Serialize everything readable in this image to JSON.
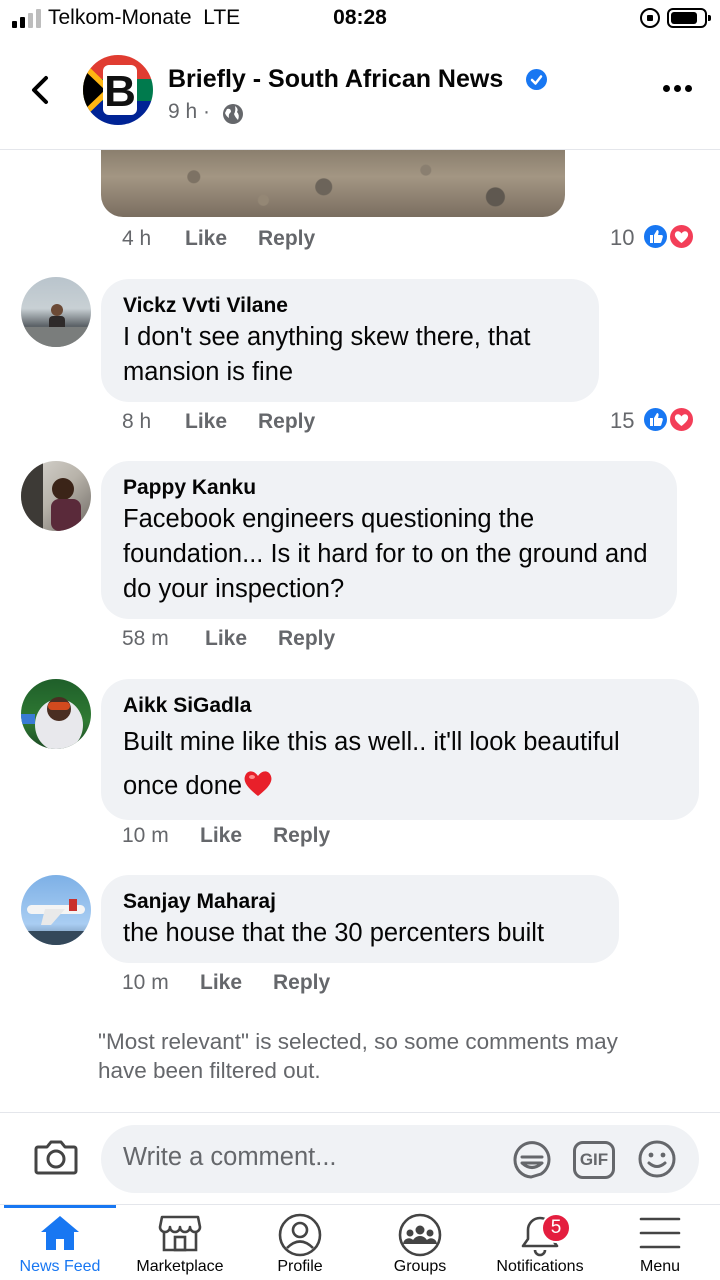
{
  "status_bar": {
    "carrier": "Telkom-Monate  LTE",
    "time": "08:28"
  },
  "header": {
    "title": "Briefly - South African News",
    "time": "9 h ·",
    "icons": [
      "back-icon",
      "verified-icon",
      "globe-icon",
      "more-icon"
    ]
  },
  "comments": [
    {
      "time": "4 h",
      "like": "Like",
      "reply": "Reply",
      "reactions": "10"
    },
    {
      "name": "Vickz Vvti Vilane",
      "text": "I don't see anything skew there, that mansion is fine",
      "time": "8 h",
      "like": "Like",
      "reply": "Reply",
      "reactions": "15"
    },
    {
      "name": "Pappy Kanku",
      "text": "Facebook engineers questioning the foundation... Is it hard for to on the ground and do your inspection?",
      "time": "58 m",
      "like": "Like",
      "reply": "Reply"
    },
    {
      "name": "Aikk SiGadla",
      "text": "Built mine like this as well.. it'll look beautiful once done",
      "emoji": "heart",
      "time": "10 m",
      "like": "Like",
      "reply": "Reply"
    },
    {
      "name": "Sanjay Maharaj",
      "text": "the house that the 30 percenters built",
      "time": "10 m",
      "like": "Like",
      "reply": "Reply"
    }
  ],
  "filter_note": "\"Most relevant\" is selected, so some comments may have been filtered out.",
  "composer": {
    "placeholder": "Write a comment...",
    "gif_label": "GIF"
  },
  "tabs": [
    {
      "label": "News Feed",
      "icon": "home-icon",
      "active": true
    },
    {
      "label": "Marketplace",
      "icon": "marketplace-icon"
    },
    {
      "label": "Profile",
      "icon": "profile-icon"
    },
    {
      "label": "Groups",
      "icon": "groups-icon"
    },
    {
      "label": "Notifications",
      "icon": "bell-icon",
      "badge": "5"
    },
    {
      "label": "Menu",
      "icon": "menu-icon"
    }
  ],
  "colors": {
    "accent": "#1877f2",
    "bubble": "#f0f2f5",
    "secondary_text": "#65676b",
    "badge": "#e41e3f",
    "love": "#f33e58"
  }
}
